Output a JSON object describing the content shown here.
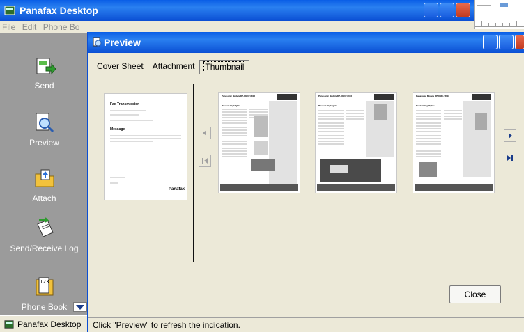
{
  "main_window": {
    "title": "Panafax Desktop",
    "menu": [
      "File",
      "Edit",
      "Phone Bo"
    ]
  },
  "sidebar": {
    "items": [
      {
        "label": "Send",
        "icon": "send-icon"
      },
      {
        "label": "Preview",
        "icon": "magnifier-document-icon"
      },
      {
        "label": "Attach",
        "icon": "folder-attach-icon"
      },
      {
        "label": "Send/Receive Log",
        "icon": "log-book-icon"
      },
      {
        "label": "Phone Book",
        "icon": "phone-book-icon"
      }
    ]
  },
  "taskbar": {
    "label": "Panafax Desktop"
  },
  "preview": {
    "title": "Preview",
    "tabs": [
      "Cover Sheet",
      "Attachment",
      "Thumbnail"
    ],
    "active_tab": "Thumbnail",
    "cover_thumbnail": {
      "heading": "Fax Transmission",
      "section": "Message",
      "brand": "Panafax"
    },
    "page_thumbnails": [
      {
        "header": "Panasonic Models DP-8020 / 8016",
        "section": "Product Highlights"
      },
      {
        "header": "Panasonic Models DP-8020 / 8016",
        "section": "Product Highlights"
      },
      {
        "header": "Panasonic Models DP-8020 / 8016",
        "section": "Product Highlights"
      }
    ],
    "close_label": "Close",
    "status_text": "Click \"Preview\" to refresh the indication."
  },
  "colors": {
    "title_bar": "#0b4fd4",
    "sidebar": "#9b9b9b",
    "dialog_bg": "#ece9d8"
  }
}
